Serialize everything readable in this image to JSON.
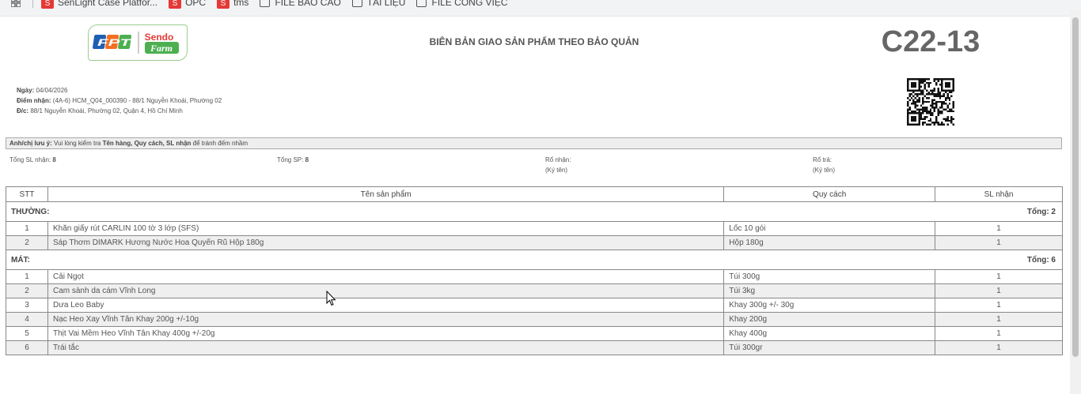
{
  "bookmarks": [
    {
      "label": "SenLight Case Platfor...",
      "icon": "senlight-icon"
    },
    {
      "label": "OPC",
      "icon": "opc-icon"
    },
    {
      "label": "tms",
      "icon": "tms-icon"
    },
    {
      "label": "FILE BÁO CÁO",
      "icon": "folder-icon"
    },
    {
      "label": "TÀI LIỆU",
      "icon": "folder-icon"
    },
    {
      "label": "FILE CÔNG VIỆC",
      "icon": "folder-icon"
    }
  ],
  "logo": {
    "left": "FPT",
    "right_top": "Sendo",
    "right_bottom": "Farm",
    "colors": {
      "blue": "#1f5fb3",
      "orange": "#f36f21",
      "green": "#4caf50",
      "red": "#e53935"
    }
  },
  "doc": {
    "title": "BIÊN BẢN GIAO SẢN PHẨM THEO BẢO QUẢN",
    "code": "C22-13",
    "date_label": "Ngày:",
    "date_value": "04/04/2026",
    "point_label": "Điểm nhận:",
    "point_value": "(4A-6) HCM_Q04_000390 - 88/1 Nguyễn Khoái, Phường 02",
    "addr_label": "Đ/c:",
    "addr_value": "88/1 Nguyễn Khoái, Phường 02, Quận 4, Hồ Chí Minh"
  },
  "note": {
    "label": "Anh/chị lưu ý:",
    "prefix": "Vui lòng kiểm tra",
    "bold": "Tên hàng, Quy cách, SL nhận",
    "suffix": "để tránh đếm nhầm"
  },
  "summary": {
    "total_qty_label": "Tổng SL nhận:",
    "total_qty": "8",
    "total_sp_label": "Tổng SP:",
    "total_sp": "8",
    "receive_label": "Rổ nhận:",
    "receive_sign": "(Ký tên)",
    "return_label": "Rổ trả:",
    "return_sign": "(Ký tên)"
  },
  "table": {
    "headers": [
      "STT",
      "Tên sản phẩm",
      "Quy cách",
      "SL nhận"
    ],
    "groups": [
      {
        "name": "THƯỜNG:",
        "total": "Tổng: 2",
        "rows": [
          {
            "stt": "1",
            "name": "Khăn giấy rút CARLIN 100 tờ 3 lớp (SFS)",
            "spec": "Lốc 10 gói",
            "qty": "1"
          },
          {
            "stt": "2",
            "name": "Sáp Thơm DIMARK Hương Nước Hoa Quyến Rũ Hộp 180g",
            "spec": "Hộp 180g",
            "qty": "1"
          }
        ]
      },
      {
        "name": "MÁT:",
        "total": "Tổng: 6",
        "rows": [
          {
            "stt": "1",
            "name": "Cải Ngọt",
            "spec": "Túi 300g",
            "qty": "1"
          },
          {
            "stt": "2",
            "name": "Cam sành da cám Vĩnh Long",
            "spec": "Túi 3kg",
            "qty": "1"
          },
          {
            "stt": "3",
            "name": "Dưa Leo Baby",
            "spec": "Khay 300g +/- 30g",
            "qty": "1"
          },
          {
            "stt": "4",
            "name": "Nạc Heo Xay Vĩnh Tân Khay 200g +/-10g",
            "spec": "Khay 200g",
            "qty": "1"
          },
          {
            "stt": "5",
            "name": "Thịt Vai Mềm Heo Vĩnh Tân Khay 400g +/-20g",
            "spec": "Khay 400g",
            "qty": "1"
          },
          {
            "stt": "6",
            "name": "Trái tắc",
            "spec": "Túi 300gr",
            "qty": "1"
          }
        ]
      }
    ]
  }
}
